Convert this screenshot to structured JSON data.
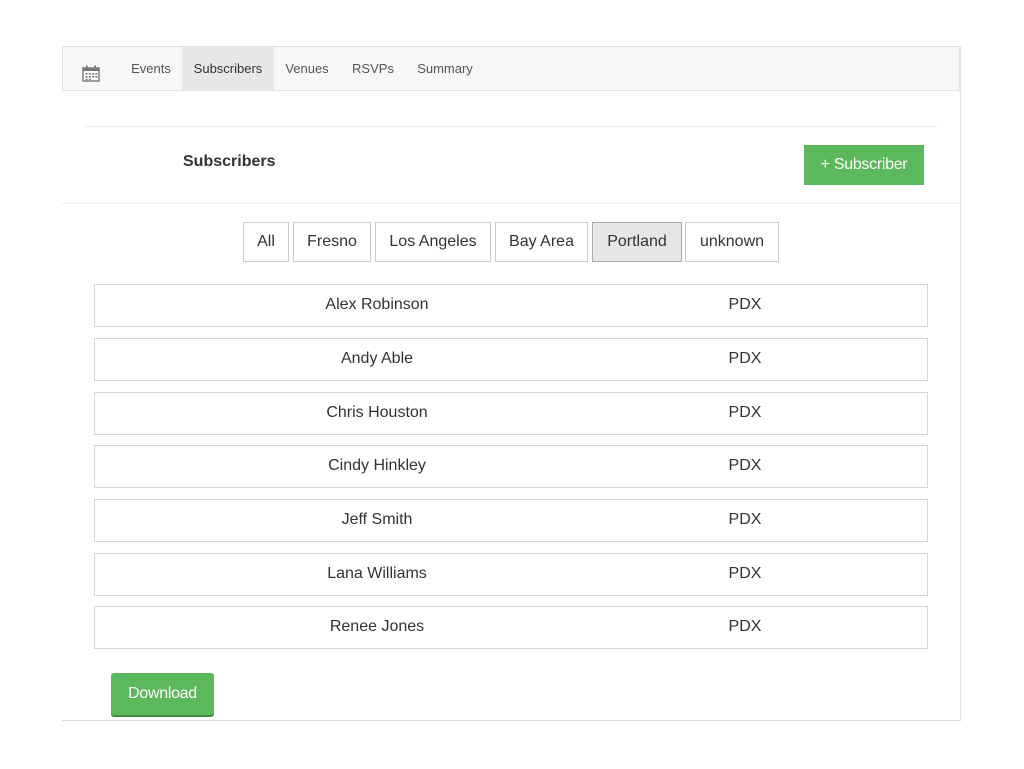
{
  "nav": {
    "icon": "calendar-icon",
    "items": [
      {
        "label": "Events"
      },
      {
        "label": "Subscribers"
      },
      {
        "label": "Venues"
      },
      {
        "label": "RSVPs"
      },
      {
        "label": "Summary"
      }
    ],
    "active": "Subscribers"
  },
  "header": {
    "title": "Subscribers",
    "add_button_label": "+ Subscriber"
  },
  "filters": {
    "items": [
      {
        "label": "All"
      },
      {
        "label": "Fresno"
      },
      {
        "label": "Los Angeles"
      },
      {
        "label": "Bay Area"
      },
      {
        "label": "Portland"
      },
      {
        "label": "unknown"
      }
    ],
    "active": "Portland"
  },
  "subscribers": [
    {
      "name": "Alex Robinson",
      "city": "PDX"
    },
    {
      "name": "Andy Able",
      "city": "PDX"
    },
    {
      "name": "Chris Houston",
      "city": "PDX"
    },
    {
      "name": "Cindy Hinkley",
      "city": "PDX"
    },
    {
      "name": "Jeff Smith",
      "city": "PDX"
    },
    {
      "name": "Lana Williams",
      "city": "PDX"
    },
    {
      "name": "Renee Jones",
      "city": "PDX"
    }
  ],
  "footer": {
    "download_label": "Download"
  },
  "colors": {
    "accent_green": "#5cb85c",
    "nav_background": "#f7f7f7",
    "active_background": "#e6e6e6"
  }
}
